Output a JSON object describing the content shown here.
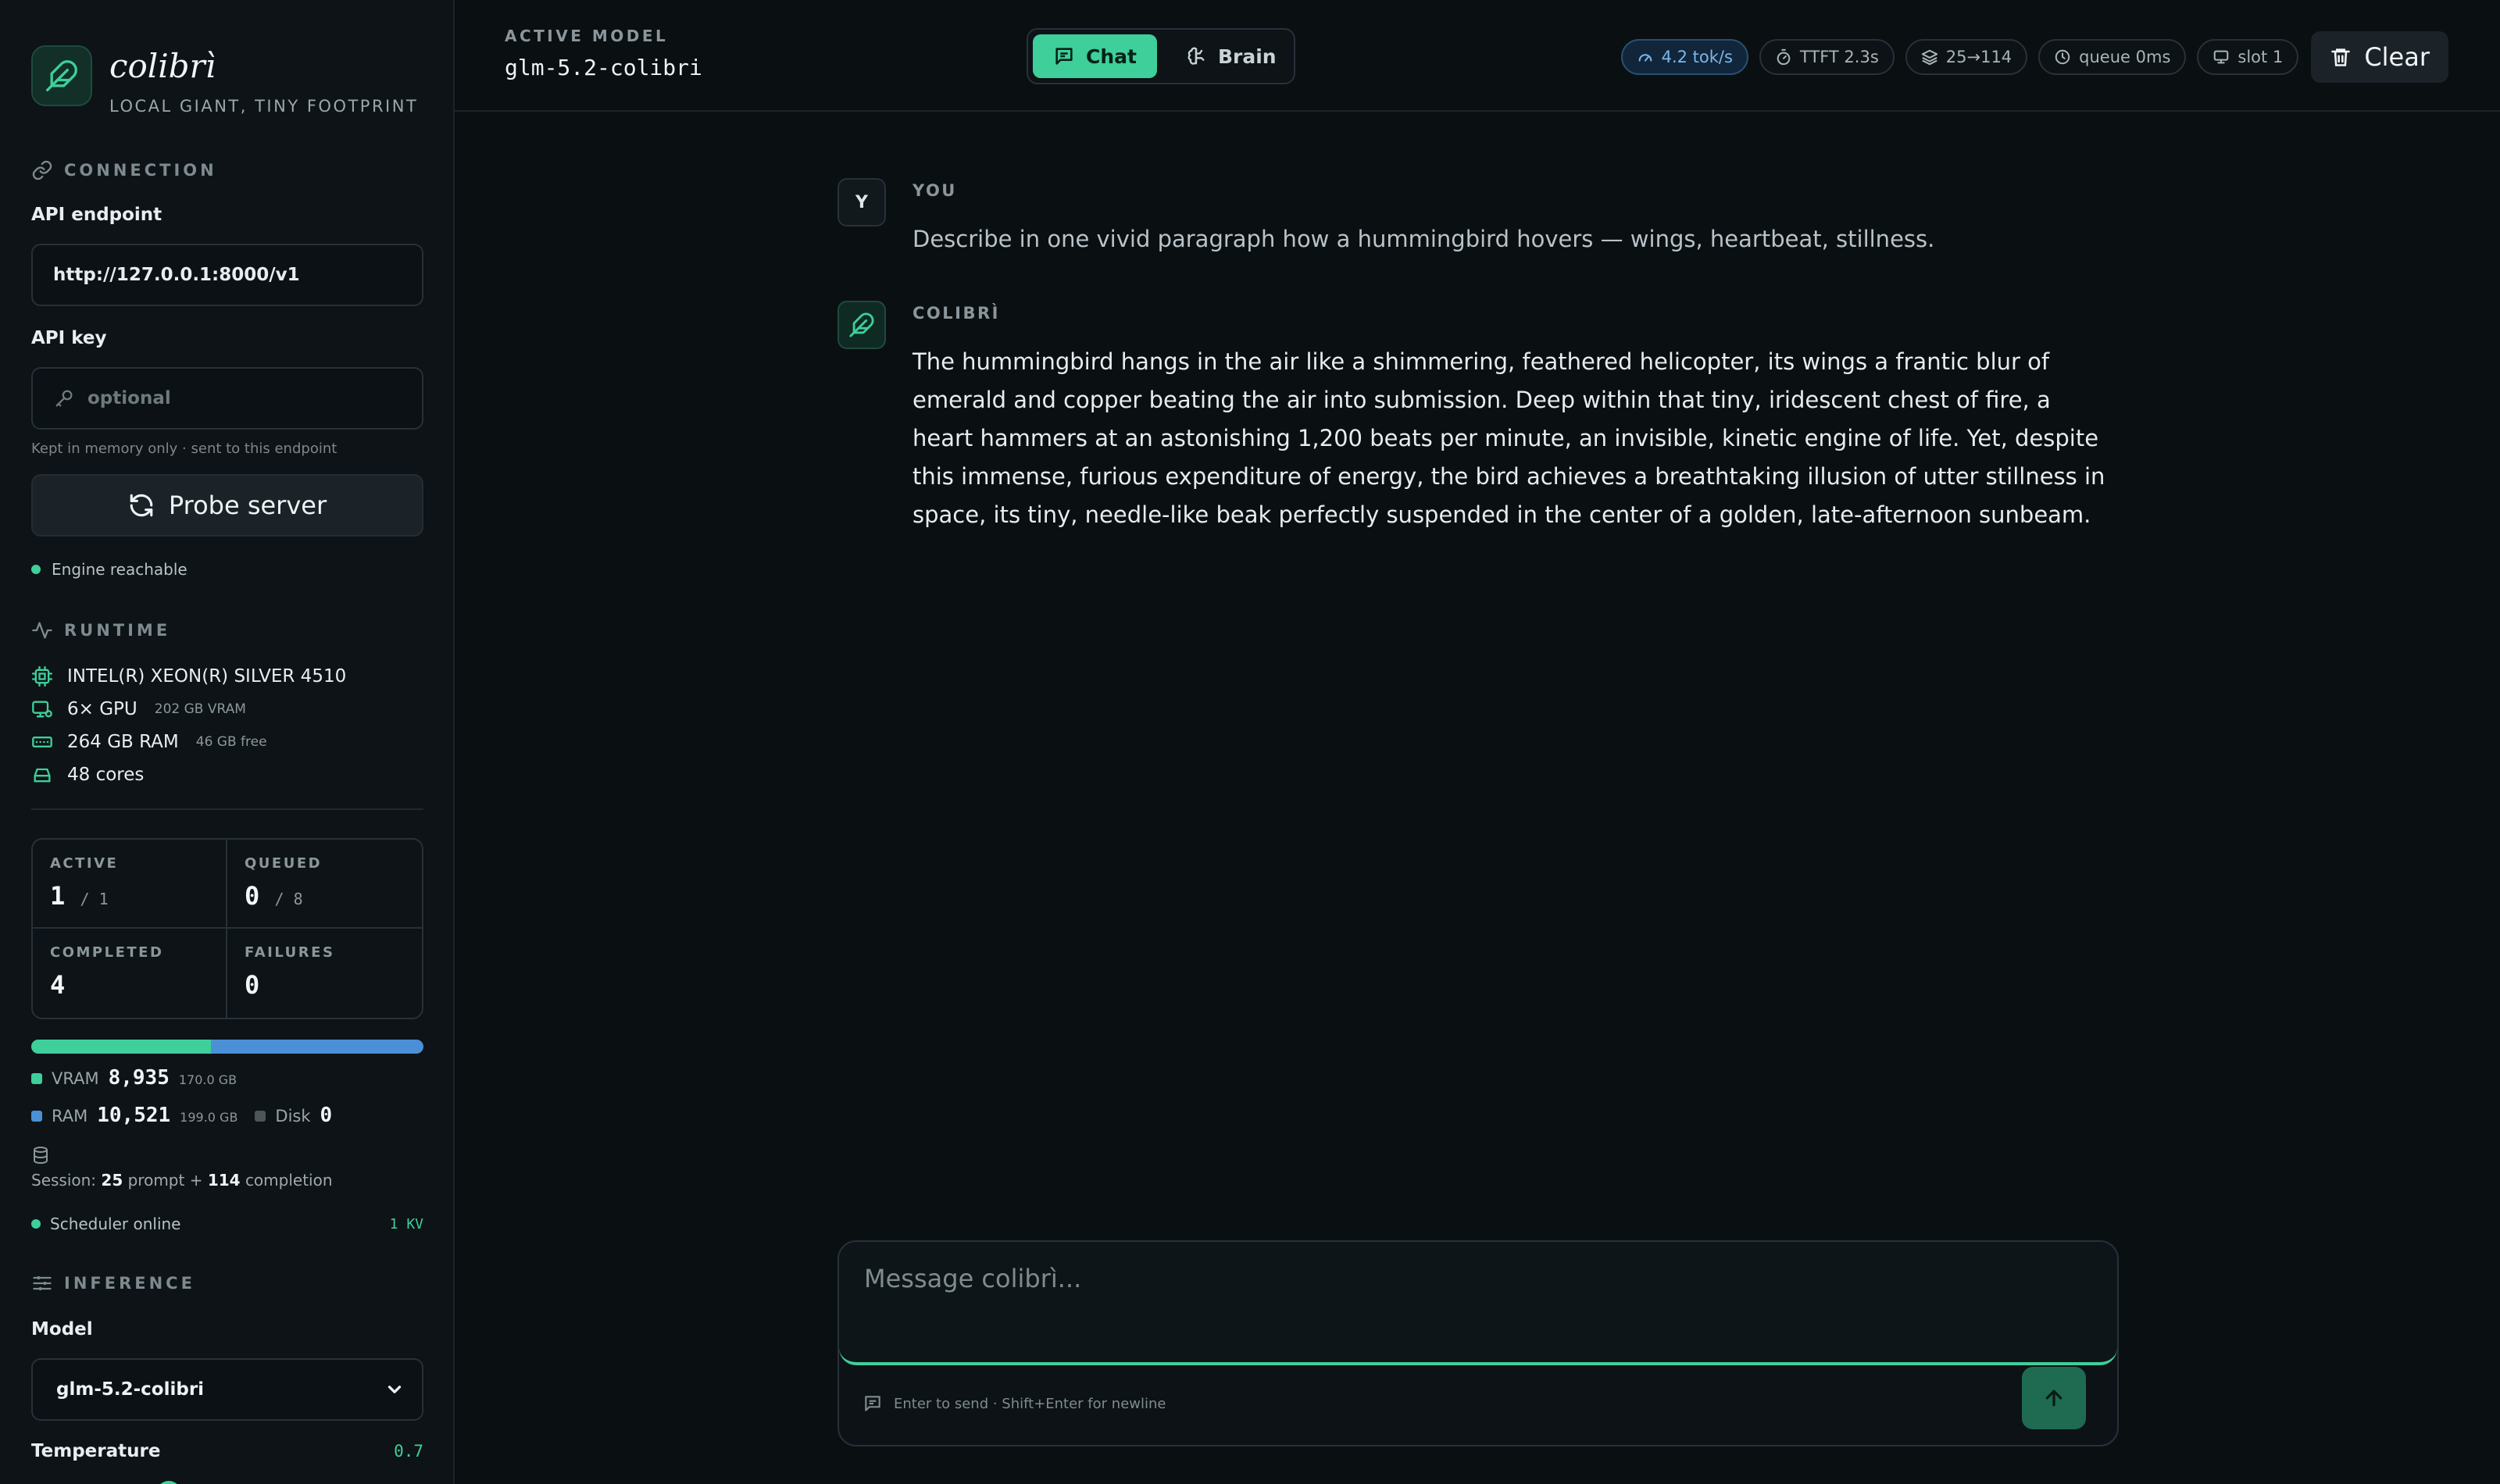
{
  "brand": {
    "name": "colibrì",
    "tagline": "LOCAL GIANT, TINY FOOTPRINT"
  },
  "connection": {
    "heading": "CONNECTION",
    "endpoint_label": "API endpoint",
    "endpoint_value": "http://127.0.0.1:8000/v1",
    "key_label": "API key",
    "key_placeholder": "optional",
    "key_hint": "Kept in memory only · sent to this endpoint",
    "probe_label": "Probe server",
    "status": "Engine reachable"
  },
  "runtime": {
    "heading": "RUNTIME",
    "cpu": "INTEL(R) XEON(R) SILVER 4510",
    "gpu": "6× GPU",
    "gpu_sub": "202 GB VRAM",
    "ram": "264 GB RAM",
    "ram_sub": "46 GB free",
    "cores": "48 cores"
  },
  "stats": {
    "active_label": "ACTIVE",
    "active_value": "1",
    "active_sub": "/ 1",
    "queued_label": "QUEUED",
    "queued_value": "0",
    "queued_sub": "/ 8",
    "completed_label": "COMPLETED",
    "completed_value": "4",
    "failures_label": "FAILURES",
    "failures_value": "0"
  },
  "memory": {
    "vram_fraction": 0.459,
    "vram_label": "VRAM",
    "vram_value": "8,935",
    "vram_sub": "170.0 GB",
    "ram_label": "RAM",
    "ram_value": "10,521",
    "ram_sub": "199.0 GB",
    "disk_label": "Disk",
    "disk_value": "0",
    "session_prefix": "Session:",
    "session_prompt": "25",
    "session_mid": "prompt +",
    "session_completion": "114",
    "session_suffix": "completion",
    "scheduler": "Scheduler online",
    "kv": "1 KV"
  },
  "inference": {
    "heading": "INFERENCE",
    "model_label": "Model",
    "model_value": "glm-5.2-colibri",
    "temp_label": "Temperature",
    "temp_value": "0.7",
    "temp_fraction": 0.35
  },
  "header": {
    "caption": "ACTIVE MODEL",
    "model": "glm-5.2-colibri",
    "tab_chat": "Chat",
    "tab_brain": "Brain",
    "speed": "4.2 tok/s",
    "ttft": "TTFT 2.3s",
    "tokens": "25→114",
    "queue": "queue 0ms",
    "slot": "slot 1",
    "clear": "Clear"
  },
  "messages": [
    {
      "author": "YOU",
      "avatar": "Y",
      "text": "Describe in one vivid paragraph how a hummingbird hovers — wings, heartbeat, stillness."
    },
    {
      "author": "COLIBRÌ",
      "text": "The hummingbird hangs in the air like a shimmering, feathered helicopter, its wings a frantic blur of emerald and copper beating the air into submission. Deep within that tiny, iridescent chest of fire, a heart hammers at an astonishing 1,200 beats per minute, an invisible, kinetic engine of life. Yet, despite this immense, furious expenditure of energy, the bird achieves a breathtaking illusion of utter stillness in space, its tiny, needle-like beak perfectly suspended in the center of a golden, late-afternoon sunbeam."
    }
  ],
  "composer": {
    "placeholder": "Message colibrì...",
    "hint": "Enter to send · Shift+Enter for newline"
  },
  "colors": {
    "accent": "#3ecf9a",
    "ram": "#4a90d6",
    "background": "#0a0f12"
  }
}
